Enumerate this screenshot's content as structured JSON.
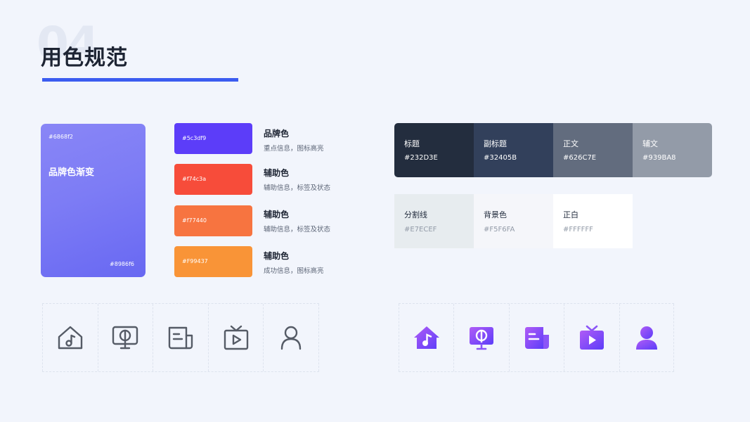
{
  "header": {
    "section_number": "04",
    "title": "用色规范"
  },
  "gradient": {
    "hex_top": "#6868f2",
    "label": "品牌色渐变",
    "hex_bottom": "#8986f6",
    "color_start": "#8986f6",
    "color_end": "#6868f2"
  },
  "brand_colors": [
    {
      "hex": "#5c3df9",
      "color": "#5c3df9",
      "name": "品牌色",
      "desc": "重点信息，图标高亮"
    },
    {
      "hex": "#f74c3a",
      "color": "#f74c3a",
      "name": "辅助色",
      "desc": "辅助信息，标签及状态"
    },
    {
      "hex": "#f77440",
      "color": "#f77440",
      "name": "辅助色",
      "desc": "辅助信息，标签及状态"
    },
    {
      "hex": "#F99437",
      "color": "#F99437",
      "name": "辅助色",
      "desc": "成功信息，图标高亮"
    }
  ],
  "neutral_colors": [
    {
      "name": "标题",
      "hex": "#232D3E",
      "color": "#232D3E"
    },
    {
      "name": "副标题",
      "hex": "#32405B",
      "color": "#32405B"
    },
    {
      "name": "正文",
      "hex": "#626C7E",
      "color": "#626C7E"
    },
    {
      "name": "辅文",
      "hex": "#939BA8",
      "color": "#939BA8"
    }
  ],
  "light_colors": [
    {
      "name": "分割线",
      "hex": "#E7ECEF",
      "color": "#E7ECEF"
    },
    {
      "name": "背景色",
      "hex": "#F5F6FA",
      "color": "#F5F6FA"
    },
    {
      "name": "正白",
      "hex": "#FFFFFF",
      "color": "#FFFFFF"
    }
  ],
  "outline_icons": [
    "home-music-icon",
    "music-screen-icon",
    "news-icon",
    "tv-play-icon",
    "user-icon"
  ],
  "filled_icons": [
    "home-music-icon",
    "music-screen-icon",
    "news-icon",
    "tv-play-icon",
    "user-icon"
  ],
  "icon_colors": {
    "outline": "#555b66",
    "fill_start": "#9a52f4",
    "fill_end": "#5c3df9"
  }
}
